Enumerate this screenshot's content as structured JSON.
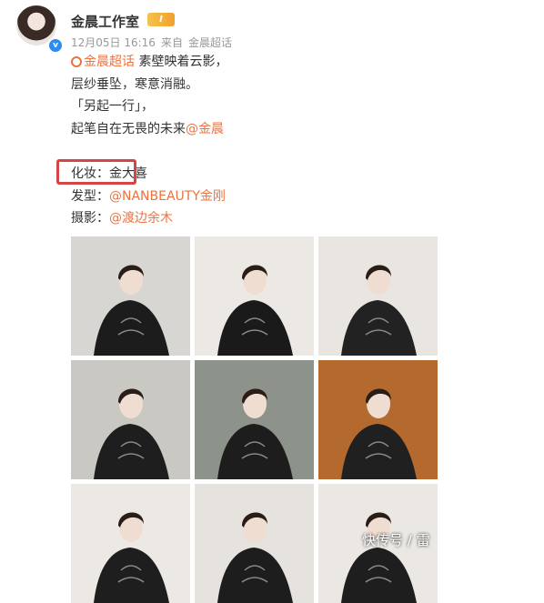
{
  "header": {
    "name": "金晨工作室",
    "level_badge": "I",
    "date": "12月05日 16:16",
    "source_prefix": "来自",
    "source": "金晨超话",
    "verified_mark": "v"
  },
  "post": {
    "topic_link": "金晨超话",
    "line1_text": " 素壁映着云影，",
    "line2": "层纱垂坠，寒意消融。",
    "line3": "「另起一行」，",
    "line4_text": "起笔自在无畏的未来",
    "line4_mention": "@金晨",
    "makeup_label": "化妆：",
    "makeup_name": "金大喜",
    "hair_label": "发型：",
    "hair_mention": "@NANBEAUTY金刚",
    "photo_label": "摄影：",
    "photo_mention": "@渡边余木"
  },
  "photos": [
    {
      "id": 1,
      "bg": "#d8d6d2",
      "dark": "#1c1c1c"
    },
    {
      "id": 2,
      "bg": "#ece8e3",
      "dark": "#1a1a1a"
    },
    {
      "id": 3,
      "bg": "#e9e6e1",
      "dark": "#222222"
    },
    {
      "id": 4,
      "bg": "#c9c8c2",
      "dark": "#1e1e1e"
    },
    {
      "id": 5,
      "bg": "#8d938a",
      "dark": "#1d1d1d"
    },
    {
      "id": 6,
      "bg": "#b4692e",
      "dark": "#202020"
    },
    {
      "id": 7,
      "bg": "#ece9e4",
      "dark": "#1e1e1e"
    },
    {
      "id": 8,
      "bg": "#e6e3de",
      "dark": "#1d1d1d"
    },
    {
      "id": 9,
      "bg": "#ebe8e3",
      "dark": "#1e1e1e"
    }
  ],
  "watermark": "快传号 / 雷"
}
